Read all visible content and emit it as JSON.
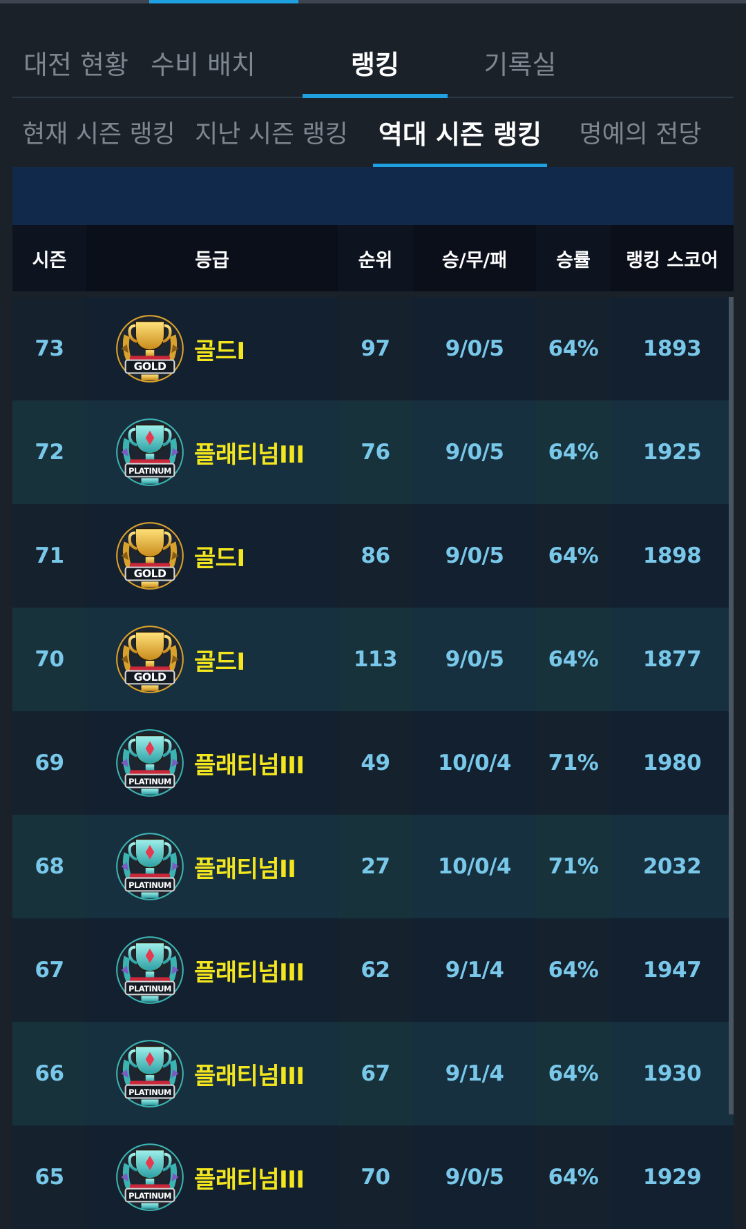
{
  "main_tabs": [
    {
      "label": "대전 현황"
    },
    {
      "label": "수비 배치"
    },
    {
      "label": "랭킹"
    },
    {
      "label": "기록실"
    }
  ],
  "sub_tabs": [
    {
      "label": "현재 시즌 랭킹"
    },
    {
      "label": "지난 시즌 랭킹"
    },
    {
      "label": "역대 시즌 랭킹"
    },
    {
      "label": "명예의 전당"
    }
  ],
  "table": {
    "headers": [
      "시즌",
      "등급",
      "순위",
      "승/무/패",
      "승률",
      "랭킹 스코어"
    ],
    "rows": [
      {
        "season": "73",
        "grade": "골드I",
        "emblem": "gold-trophy-icon",
        "rank": "97",
        "record": "9/0/5",
        "rate": "64%",
        "score": "1893"
      },
      {
        "season": "72",
        "grade": "플래티넘III",
        "emblem": "platinum-trophy-icon",
        "rank": "76",
        "record": "9/0/5",
        "rate": "64%",
        "score": "1925"
      },
      {
        "season": "71",
        "grade": "골드I",
        "emblem": "gold-trophy-icon",
        "rank": "86",
        "record": "9/0/5",
        "rate": "64%",
        "score": "1898"
      },
      {
        "season": "70",
        "grade": "골드I",
        "emblem": "gold-trophy-icon",
        "rank": "113",
        "record": "9/0/5",
        "rate": "64%",
        "score": "1877"
      },
      {
        "season": "69",
        "grade": "플래티넘III",
        "emblem": "platinum-trophy-icon",
        "rank": "49",
        "record": "10/0/4",
        "rate": "71%",
        "score": "1980"
      },
      {
        "season": "68",
        "grade": "플래티넘II",
        "emblem": "platinum-trophy-icon",
        "rank": "27",
        "record": "10/0/4",
        "rate": "71%",
        "score": "2032"
      },
      {
        "season": "67",
        "grade": "플래티넘III",
        "emblem": "platinum-trophy-icon",
        "rank": "62",
        "record": "9/1/4",
        "rate": "64%",
        "score": "1947"
      },
      {
        "season": "66",
        "grade": "플래티넘III",
        "emblem": "platinum-trophy-icon",
        "rank": "67",
        "record": "9/1/4",
        "rate": "64%",
        "score": "1930"
      },
      {
        "season": "65",
        "grade": "플래티넘III",
        "emblem": "platinum-trophy-icon",
        "rank": "70",
        "record": "9/0/5",
        "rate": "64%",
        "score": "1929"
      }
    ]
  },
  "emblem_text": {
    "gold": "GOLD",
    "platinum": "PLATINUM"
  },
  "colors": {
    "accent": "#1fa0e0",
    "grade_text": "#f4e61e",
    "cell_text": "#79c8ea"
  }
}
